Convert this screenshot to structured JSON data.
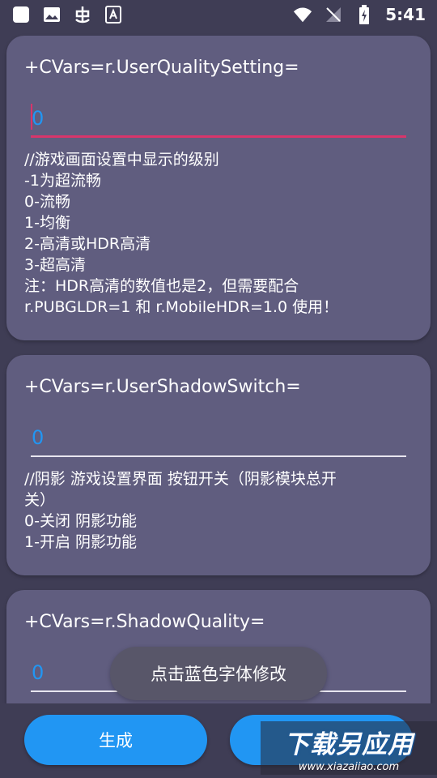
{
  "status_bar": {
    "time": "5:41",
    "left_icons": [
      "app-square-icon",
      "image-icon",
      "bug-icon",
      "sim-a-icon"
    ],
    "right_icons": [
      "wifi-icon",
      "no-sim-icon",
      "battery-charging-icon"
    ]
  },
  "cards": [
    {
      "title": "+CVars=r.UserQualitySetting=",
      "value": "0",
      "description": "//游戏画面设置中显示的级别\n-1为超流畅\n0-流畅\n1-均衡\n2-高清或HDR高清\n3-超高清\n注：HDR高清的数值也是2，但需要配合\nr.PUBGLDR=1 和 r.MobileHDR=1.0 使用！"
    },
    {
      "title": "+CVars=r.UserShadowSwitch=",
      "value": "0",
      "description": "//阴影 游戏设置界面 按钮开关（阴影模块总开\n关）\n0-关闭 阴影功能\n1-开启 阴影功能"
    },
    {
      "title": "+CVars=r.ShadowQuality=",
      "value": "0",
      "description": ""
    }
  ],
  "toast": "点击蓝色字体修改",
  "bottom": {
    "generate_label": "生成",
    "second_label": ""
  },
  "watermark": {
    "main": "下载另应用",
    "sub": "www.xiazaiiao.com"
  },
  "colors": {
    "background": "#3f3d55",
    "card": "#605d7f",
    "accent_blue": "#2196f3",
    "focus_pink": "#d8356b"
  }
}
